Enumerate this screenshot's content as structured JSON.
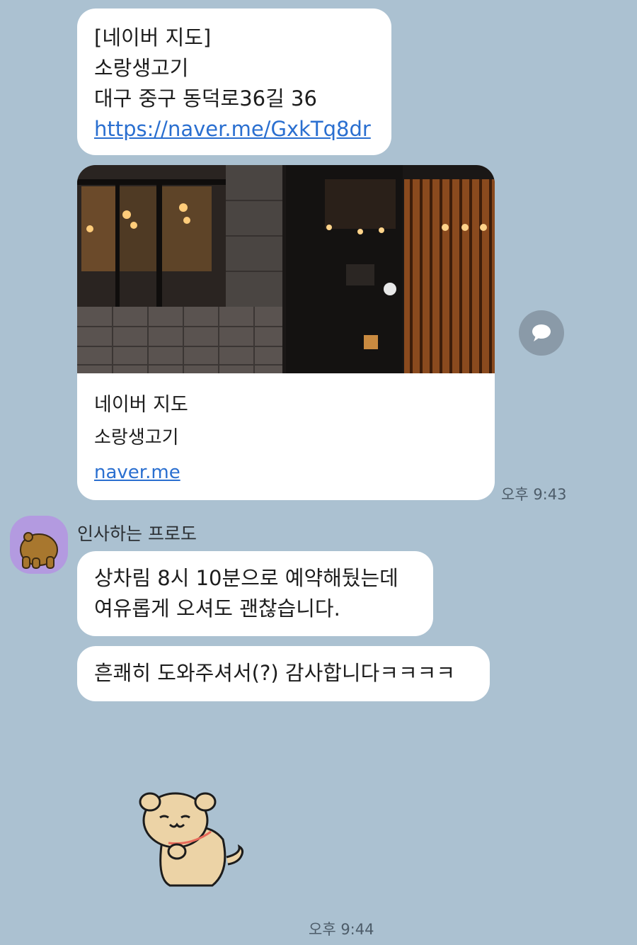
{
  "messages": {
    "first": {
      "line1": "[네이버 지도]",
      "line2": "소랑생고기",
      "line3": "대구 중구 동덕로36길 36",
      "link": "https://naver.me/GxkTq8dr"
    },
    "preview": {
      "title": "네이버 지도",
      "subtitle": "소랑생고기",
      "domain": "naver.me"
    },
    "time1": "오후 9:43",
    "sender_name": "인사하는 프로도",
    "second": {
      "line1": "상차림 8시 10분으로 예약해뒀는데",
      "line2": "여유롭게 오셔도 괜찮습니다."
    },
    "third": "흔쾌히 도와주셔서(?) 감사합니다ㅋㅋㅋㅋ",
    "time2": "오후 9:44"
  },
  "icons": {
    "share": "share-speech-icon",
    "avatar": "bear-avatar-icon",
    "sticker": "dog-sticker"
  },
  "colors": {
    "background": "#abc1d1",
    "bubble": "#ffffff",
    "link": "#2a6fd0",
    "avatar_bg": "#b39ae0"
  }
}
